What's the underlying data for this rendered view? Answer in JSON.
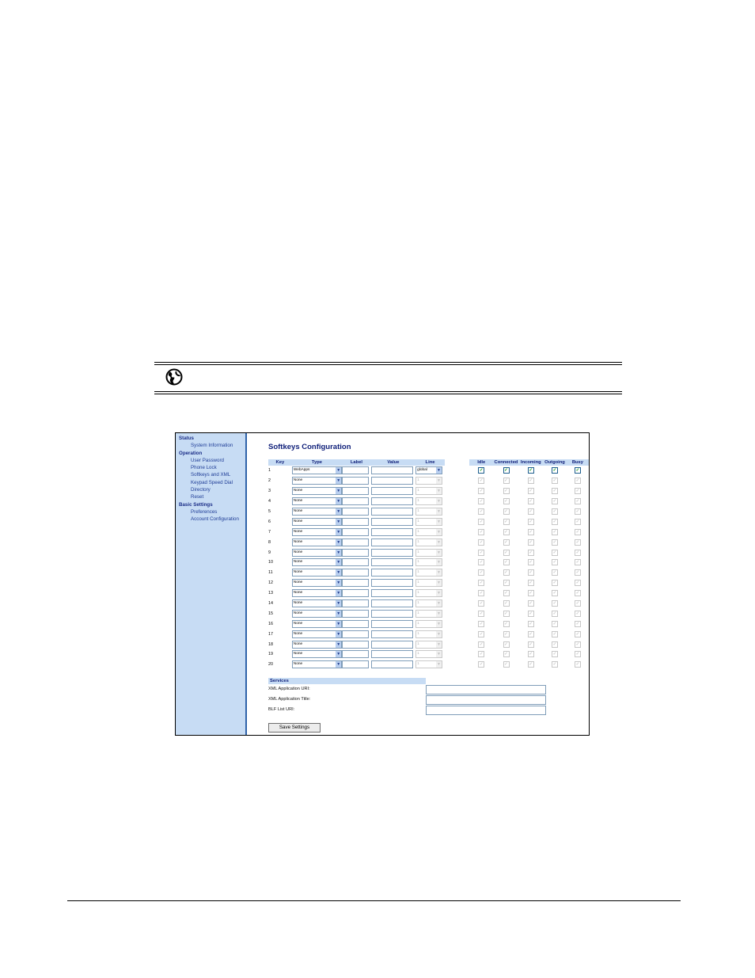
{
  "sidebar": {
    "sections": [
      {
        "heading": "Status",
        "items": [
          "System Information"
        ]
      },
      {
        "heading": "Operation",
        "items": [
          "User Password",
          "Phone Lock",
          "Softkeys and XML",
          "Keypad Speed Dial",
          "Directory",
          "Reset"
        ]
      },
      {
        "heading": "Basic Settings",
        "items": [
          "Preferences",
          "Account Configuration"
        ]
      }
    ]
  },
  "page": {
    "title": "Softkeys Configuration",
    "columns": [
      "Key",
      "Type",
      "Label",
      "Value",
      "Line",
      "Idle",
      "Connected",
      "Incoming",
      "Outgoing",
      "Busy"
    ],
    "rows": [
      {
        "key": "1",
        "type": "WebApps",
        "line": "global",
        "active": true
      },
      {
        "key": "2",
        "type": "None",
        "line": "1",
        "active": false
      },
      {
        "key": "3",
        "type": "None",
        "line": "1",
        "active": false
      },
      {
        "key": "4",
        "type": "None",
        "line": "1",
        "active": false
      },
      {
        "key": "5",
        "type": "None",
        "line": "1",
        "active": false
      },
      {
        "key": "6",
        "type": "None",
        "line": "1",
        "active": false
      },
      {
        "key": "7",
        "type": "None",
        "line": "1",
        "active": false
      },
      {
        "key": "8",
        "type": "None",
        "line": "1",
        "active": false
      },
      {
        "key": "9",
        "type": "None",
        "line": "1",
        "active": false
      },
      {
        "key": "10",
        "type": "None",
        "line": "1",
        "active": false
      },
      {
        "key": "11",
        "type": "None",
        "line": "1",
        "active": false
      },
      {
        "key": "12",
        "type": "None",
        "line": "1",
        "active": false
      },
      {
        "key": "13",
        "type": "None",
        "line": "1",
        "active": false
      },
      {
        "key": "14",
        "type": "None",
        "line": "1",
        "active": false
      },
      {
        "key": "15",
        "type": "None",
        "line": "1",
        "active": false
      },
      {
        "key": "16",
        "type": "None",
        "line": "1",
        "active": false
      },
      {
        "key": "17",
        "type": "None",
        "line": "1",
        "active": false
      },
      {
        "key": "18",
        "type": "None",
        "line": "1",
        "active": false
      },
      {
        "key": "19",
        "type": "None",
        "line": "1",
        "active": false
      },
      {
        "key": "20",
        "type": "None",
        "line": "1",
        "active": false
      }
    ]
  },
  "services": {
    "heading": "Services",
    "fields": [
      {
        "label": "XML Application URI:",
        "value": ""
      },
      {
        "label": "XML Application Title:",
        "value": ""
      },
      {
        "label": "BLF List URI:",
        "value": ""
      }
    ]
  },
  "save_label": "Save Settings",
  "icons": {
    "note": "globe-icon",
    "dropdown": "chevron-down-icon",
    "check": "checkmark-icon"
  },
  "colors": {
    "sidebar_bg": "#c7dcf4",
    "accent": "#10207a",
    "border": "#2e62a8"
  }
}
